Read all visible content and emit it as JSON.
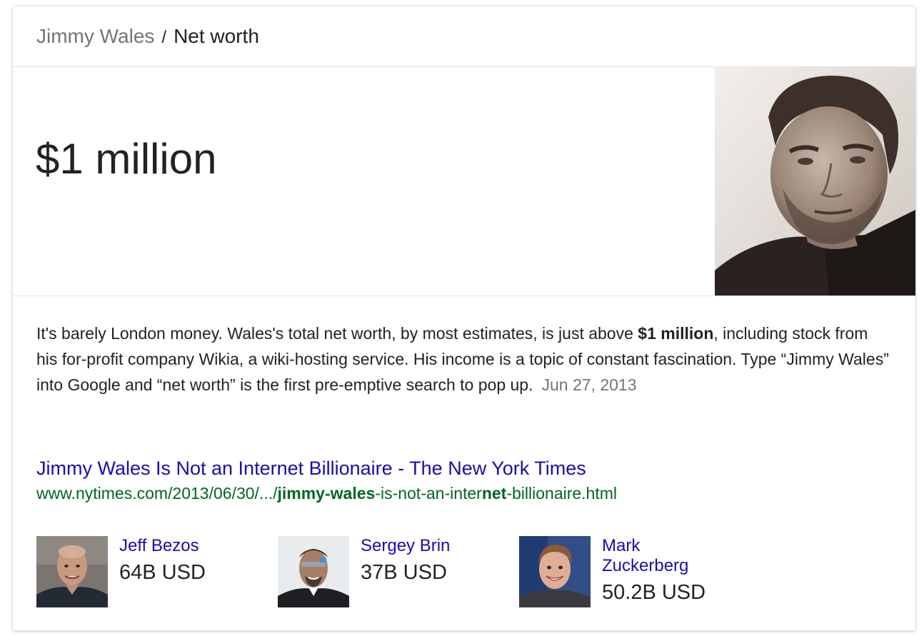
{
  "breadcrumb": {
    "parent": "Jimmy Wales",
    "separator": "/",
    "current": "Net worth"
  },
  "answer": {
    "amount": "$1 million",
    "portrait_icon": "portrait-photo"
  },
  "snippet": {
    "before": "It's barely London money. Wales's total net worth, by most estimates, is just above ",
    "bold": "$1 million",
    "after": ", including stock from his for-profit company Wikia, a wiki-hosting service. His income is a topic of constant fascination. Type “Jimmy Wales” into Google and “net worth” is the first pre-emptive search to pop up.",
    "date": "Jun 27, 2013"
  },
  "result": {
    "title": "Jimmy Wales Is Not an Internet Billionaire - The New York Times",
    "url_parts": [
      {
        "text": "www.nytimes.com/2013/06/30/.../",
        "bold": false
      },
      {
        "text": "jimmy-wales",
        "bold": true
      },
      {
        "text": "-is-not-an-inter",
        "bold": false
      },
      {
        "text": "net",
        "bold": true
      },
      {
        "text": "-billionaire.html",
        "bold": false
      }
    ]
  },
  "people": [
    {
      "name": "Jeff Bezos",
      "worth": "64B USD"
    },
    {
      "name": "Sergey Brin",
      "worth": "37B USD"
    },
    {
      "name": "Mark Zuckerberg",
      "worth": "50.2B USD"
    }
  ],
  "colors": {
    "link": "#1a0dab",
    "url": "#006621",
    "muted": "#70757a",
    "text": "#222222"
  }
}
